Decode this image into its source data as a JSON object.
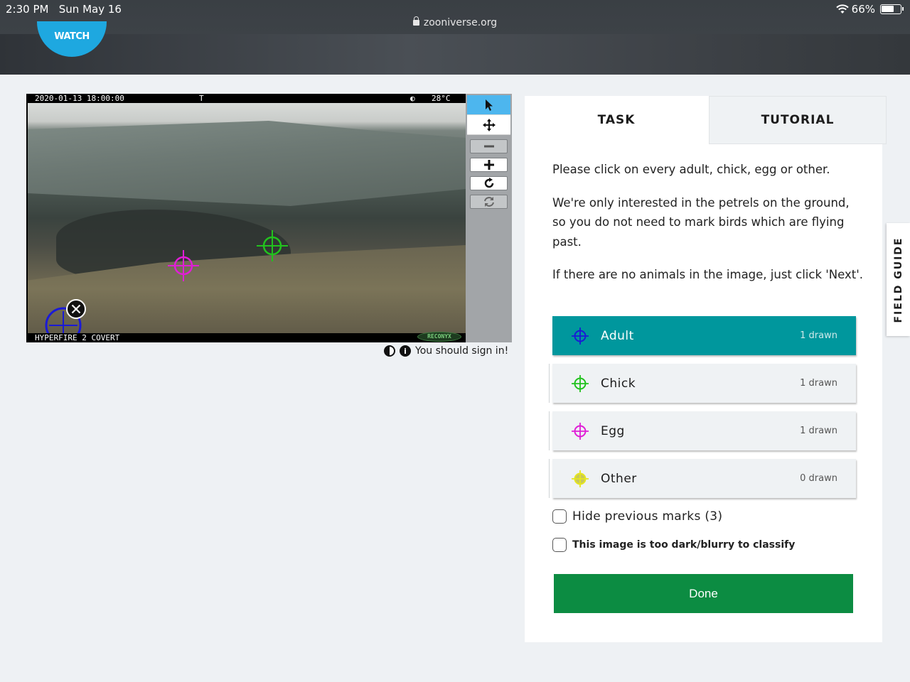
{
  "status_bar": {
    "time": "2:30 PM",
    "date": "Sun May 16",
    "battery": "66%"
  },
  "browser": {
    "url": "zooniverse.org"
  },
  "header": {
    "logo_text": "WATCH"
  },
  "camera": {
    "timestamp": "2020-01-13 18:00:00",
    "flag": "T",
    "temperature": "28°C",
    "model": "HYPERFIRE 2 COVERT",
    "brand": "RECONYX"
  },
  "viewer": {
    "sign_in_notice": "You should sign in!"
  },
  "tabs": {
    "task": "TASK",
    "tutorial": "TUTORIAL"
  },
  "instructions": [
    "Please click on every adult, chick, egg or other.",
    "We're only interested in the petrels on the ground, so you do not need to mark birds which are flying past.",
    "If there are no animals in the image, just click 'Next'."
  ],
  "answers": [
    {
      "label": "Adult",
      "count": "1 drawn",
      "color": "#1a1ad6",
      "icon": "crosshair-icon"
    },
    {
      "label": "Chick",
      "count": "1 drawn",
      "color": "#22c21e",
      "icon": "crosshair-icon"
    },
    {
      "label": "Egg",
      "count": "1 drawn",
      "color": "#e01ed6",
      "icon": "crosshair-icon"
    },
    {
      "label": "Other",
      "count": "0 drawn",
      "color": "#e6e61e",
      "icon": "crosshair-icon"
    }
  ],
  "options": {
    "hide_marks": "Hide previous marks (3)",
    "too_dark": "This image is too dark/blurry to classify"
  },
  "done_label": "Done",
  "field_guide": "FIELD GUIDE",
  "colors": {
    "selected": "#00979d",
    "done": "#0c8c42",
    "tool_active": "#4db6ee"
  }
}
